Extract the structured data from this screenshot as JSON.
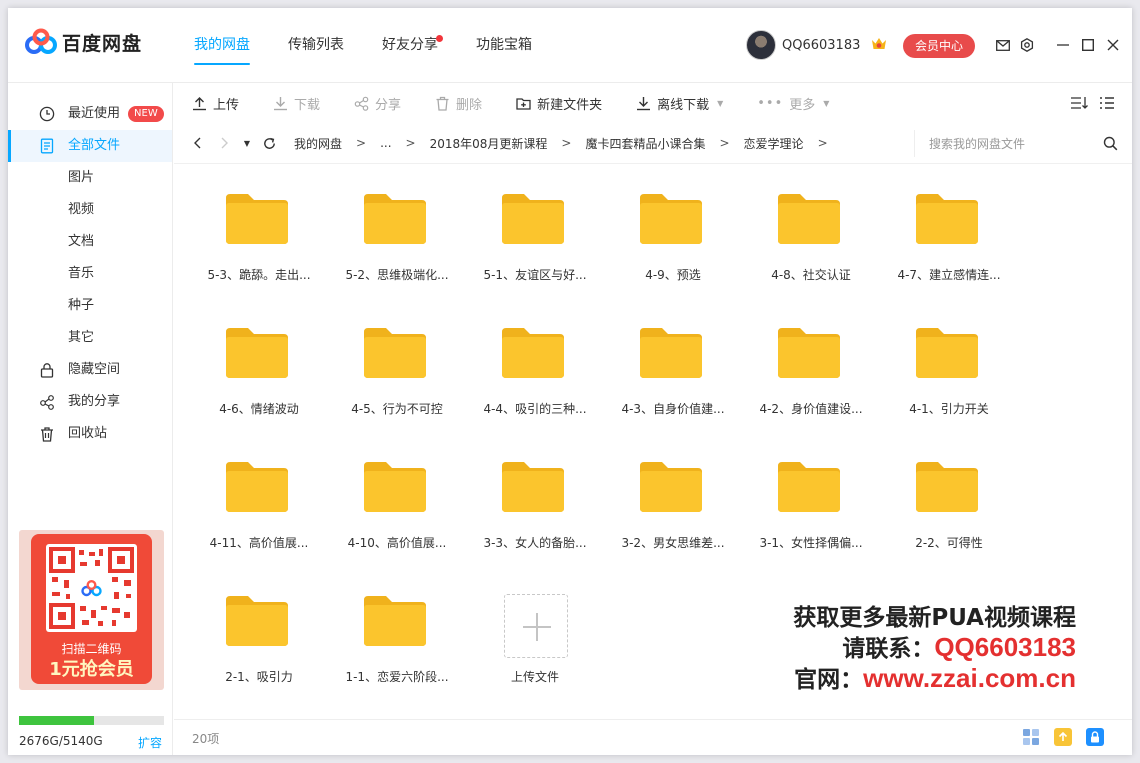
{
  "app": {
    "name": "百度网盘"
  },
  "nav": {
    "tabs": [
      {
        "label": "我的网盘",
        "active": true
      },
      {
        "label": "传输列表"
      },
      {
        "label": "好友分享",
        "dot": true
      },
      {
        "label": "功能宝箱"
      }
    ]
  },
  "user": {
    "name": "QQ6603183",
    "member_button": "会员中心"
  },
  "sidebar": {
    "items": [
      {
        "label": "最近使用",
        "badge": "NEW",
        "icon": "clock-icon"
      },
      {
        "label": "全部文件",
        "icon": "document-icon",
        "active": true
      },
      {
        "label": "图片"
      },
      {
        "label": "视频"
      },
      {
        "label": "文档"
      },
      {
        "label": "音乐"
      },
      {
        "label": "种子"
      },
      {
        "label": "其它"
      },
      {
        "label": "隐藏空间",
        "icon": "lock-icon"
      },
      {
        "label": "我的分享",
        "icon": "share-icon"
      },
      {
        "label": "回收站",
        "icon": "trash-icon"
      }
    ],
    "ad": {
      "line1": "扫描二维码",
      "line2": "1元抢会员"
    },
    "storage": {
      "used_text": "2676G/5140G",
      "used_fraction": 0.52,
      "expand": "扩容"
    }
  },
  "toolbar": {
    "upload": "上传",
    "download": "下载",
    "share": "分享",
    "delete": "删除",
    "new_folder": "新建文件夹",
    "offline_download": "离线下载",
    "more": "更多"
  },
  "pathbar": {
    "crumbs": [
      "我的网盘",
      "...",
      "2018年08月更新课程",
      "魔卡四套精品小课合集",
      "恋爱学理论"
    ],
    "separator": ">",
    "search_placeholder": "搜索我的网盘文件"
  },
  "files": [
    "5-3、跪舔。走出...",
    "5-2、思维极端化...",
    "5-1、友谊区与好...",
    "4-9、预选",
    "4-8、社交认证",
    "4-7、建立感情连...",
    "4-6、情绪波动",
    "4-5、行为不可控",
    "4-4、吸引的三种...",
    "4-3、自身价值建...",
    "4-2、身价值建设...",
    "4-1、引力开关",
    "4-11、高价值展...",
    "4-10、高价值展...",
    "3-3、女人的备胎...",
    "3-2、男女思维差...",
    "3-1、女性择偶偏...",
    "2-2、可得性",
    "2-1、吸引力",
    "1-1、恋爱六阶段..."
  ],
  "upload_tile": {
    "label": "上传文件"
  },
  "watermark": {
    "line1": "获取更多最新PUA视频课程",
    "line2_prefix": "请联系：",
    "line2_value": "QQ6603183",
    "line3_prefix": "官网：",
    "line3_value": "www.zzai.com.cn"
  },
  "status": {
    "count": "20项"
  },
  "colors": {
    "accent": "#06a7ff",
    "folder": "#fbc52d",
    "folder_tab": "#f0b21c",
    "member": "#e84b4b",
    "storage": "#3ec43e"
  }
}
